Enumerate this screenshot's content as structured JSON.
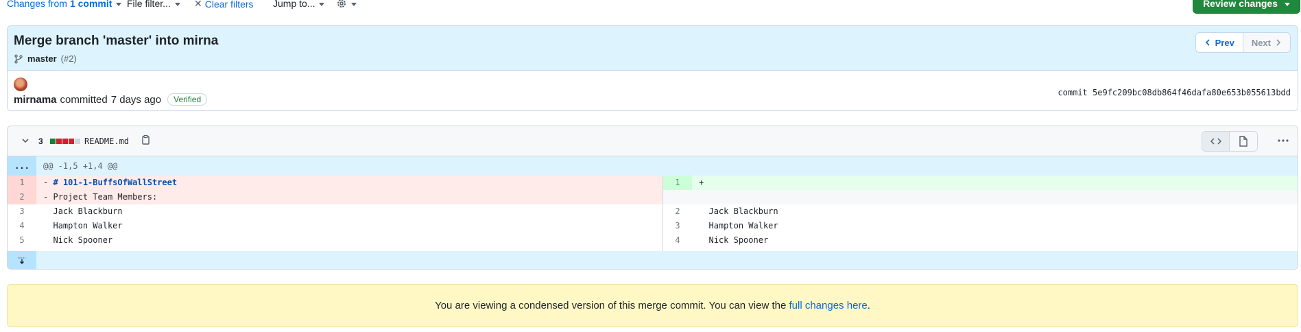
{
  "toolbar": {
    "changes_prefix": "Changes from",
    "changes_count": "1 commit",
    "file_filter": "File filter...",
    "clear_filters": "Clear filters",
    "jump_to": "Jump to...",
    "review_changes": "Review changes"
  },
  "commit": {
    "title": "Merge branch 'master' into mirna",
    "branch": "master",
    "pr_ref": "(#2)",
    "prev_label": "Prev",
    "next_label": "Next",
    "author": "mirnama",
    "action": "committed",
    "time": "7 days ago",
    "verified": "Verified",
    "sha_label": "commit",
    "sha": "5e9fc209bc08db864f46dafa80e653b055613bdd"
  },
  "diff": {
    "changes": "3",
    "filename": "README.md",
    "diffstat": [
      "add",
      "del",
      "del",
      "del",
      "neutral"
    ],
    "hunk_expand": "...",
    "hunk_header": "@@ -1,5 +1,4 @@",
    "left_lines": [
      {
        "num": "1",
        "type": "del",
        "sign": "-",
        "text": "# 101-1-BuffsOfWallStreet"
      },
      {
        "num": "2",
        "type": "del",
        "sign": "-",
        "text": "Project Team Members:"
      },
      {
        "num": "3",
        "type": "ctx",
        "sign": " ",
        "text": "Jack Blackburn"
      },
      {
        "num": "4",
        "type": "ctx",
        "sign": " ",
        "text": "Hampton Walker"
      },
      {
        "num": "5",
        "type": "ctx",
        "sign": " ",
        "text": "Nick Spooner"
      }
    ],
    "right_lines": [
      {
        "num": "1",
        "type": "add",
        "sign": "+",
        "text": ""
      },
      {
        "num": "",
        "type": "empty",
        "sign": "",
        "text": ""
      },
      {
        "num": "2",
        "type": "ctx",
        "sign": " ",
        "text": "Jack Blackburn"
      },
      {
        "num": "3",
        "type": "ctx",
        "sign": " ",
        "text": "Hampton Walker"
      },
      {
        "num": "4",
        "type": "ctx",
        "sign": " ",
        "text": "Nick Spooner"
      }
    ]
  },
  "banner": {
    "text": "You are viewing a condensed version of this merge commit. You can view the",
    "link": "full changes here",
    "suffix": "."
  },
  "colors": {
    "accent": "#0969da",
    "success": "#1f883d",
    "deletion": "#ffebe9",
    "addition": "#e6ffec"
  },
  "icons": [
    "caret-down-icon",
    "close-icon",
    "gear-icon",
    "git-branch-icon",
    "chevron-left-icon",
    "chevron-right-icon",
    "chevron-down-icon",
    "copy-icon",
    "code-icon",
    "file-icon",
    "kebab-icon",
    "unfold-icon"
  ]
}
